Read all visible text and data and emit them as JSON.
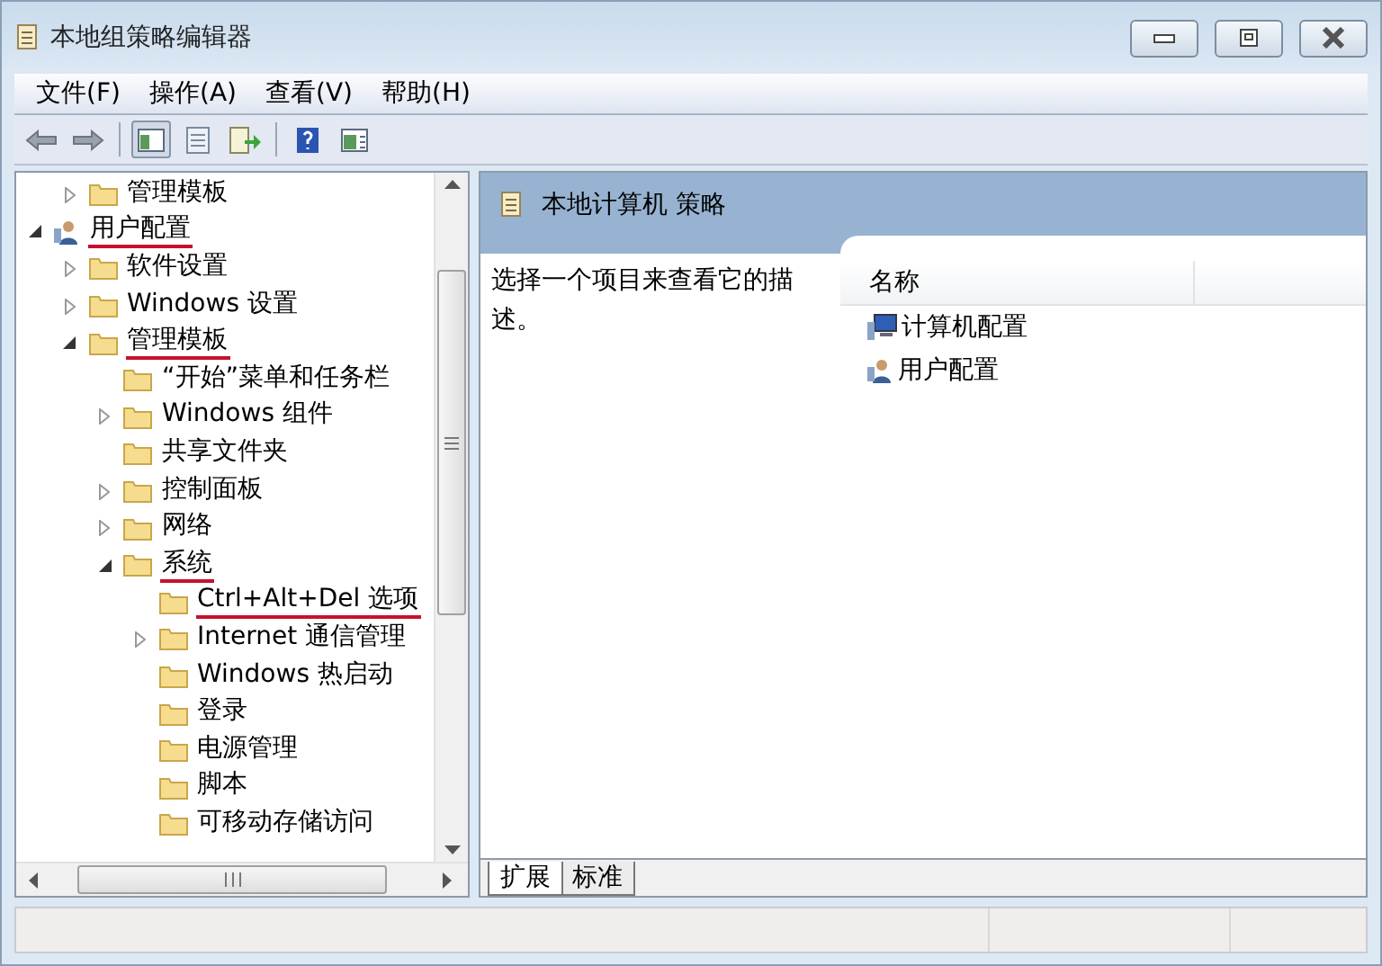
{
  "window": {
    "title": "本地组策略编辑器"
  },
  "menu": [
    "文件(F)",
    "操作(A)",
    "查看(V)",
    "帮助(H)"
  ],
  "toolbar": [
    {
      "kind": "back",
      "pressed": false
    },
    {
      "kind": "forward",
      "pressed": false
    },
    {
      "kind": "separator"
    },
    {
      "kind": "tree",
      "pressed": true
    },
    {
      "kind": "properties",
      "pressed": false
    },
    {
      "kind": "export",
      "pressed": false
    },
    {
      "kind": "separator"
    },
    {
      "kind": "help",
      "pressed": false
    },
    {
      "kind": "panel",
      "pressed": false
    }
  ],
  "tree": [
    {
      "children": [
        {
          "label": "管理模板",
          "kind": "folder",
          "expanded": false,
          "underlined": false
        }
      ]
    },
    {
      "label": "用户配置",
      "kind": "user",
      "expanded": true,
      "underlined": true,
      "children": [
        {
          "label": "软件设置",
          "kind": "folder",
          "expanded": false,
          "underlined": false
        },
        {
          "label": "Windows 设置",
          "kind": "folder",
          "expanded": false,
          "underlined": false
        },
        {
          "label": "管理模板",
          "kind": "folder",
          "expanded": true,
          "underlined": true,
          "children": [
            {
              "label": "“开始”菜单和任务栏",
              "kind": "folder",
              "underlined": false
            },
            {
              "label": "Windows 组件",
              "kind": "folder",
              "expanded": false,
              "underlined": false
            },
            {
              "label": "共享文件夹",
              "kind": "folder",
              "underlined": false
            },
            {
              "label": "控制面板",
              "kind": "folder",
              "expanded": false,
              "underlined": false
            },
            {
              "label": "网络",
              "kind": "folder",
              "expanded": false,
              "underlined": false
            },
            {
              "label": "系统",
              "kind": "folder",
              "expanded": true,
              "underlined": true,
              "children": [
                {
                  "label": "Ctrl+Alt+Del 选项",
                  "kind": "folder",
                  "underlined": true
                },
                {
                  "label": "Internet 通信管理",
                  "kind": "folder",
                  "expanded": false,
                  "underlined": false
                },
                {
                  "label": "Windows 热启动",
                  "kind": "folder",
                  "underlined": false
                },
                {
                  "label": "登录",
                  "kind": "folder",
                  "underlined": false
                },
                {
                  "label": "电源管理",
                  "kind": "folder",
                  "underlined": false
                },
                {
                  "label": "脚本",
                  "kind": "folder",
                  "underlined": false
                },
                {
                  "label": "可移动存储访问",
                  "kind": "folder",
                  "underlined": false
                }
              ]
            }
          ]
        }
      ]
    }
  ],
  "details": {
    "title": "本地计算机 策略",
    "description": "选择一个项目来查看它的描述。",
    "columns": [
      "名称"
    ],
    "rows": [
      {
        "label": "计算机配置",
        "kind": "computer"
      },
      {
        "label": "用户配置",
        "kind": "user"
      }
    ]
  },
  "tabs": [
    {
      "label": "扩展",
      "selected": true
    },
    {
      "label": "标准",
      "selected": false
    }
  ]
}
